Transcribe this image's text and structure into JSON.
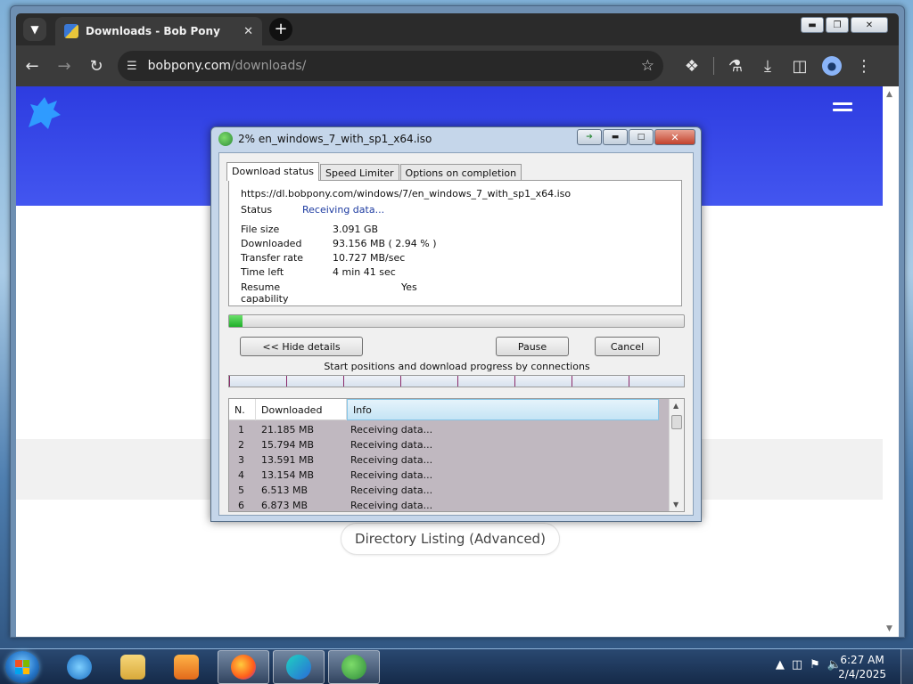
{
  "browser": {
    "tab_title": "Downloads - Bob Pony",
    "new_tab": "+",
    "url_host": "bobpony.com",
    "url_path": "/downloads/"
  },
  "page": {
    "directory_button": "Directory Listing (Advanced)"
  },
  "dialog": {
    "title": "2% en_windows_7_with_sp1_x64.iso",
    "tabs": [
      "Download status",
      "Speed Limiter",
      "Options on completion"
    ],
    "url": "https://dl.bobpony.com/windows/7/en_windows_7_with_sp1_x64.iso",
    "status_label": "Status",
    "status_value": "Receiving data...",
    "fields": {
      "file_size_label": "File size",
      "file_size": "3.091  GB",
      "downloaded_label": "Downloaded",
      "downloaded": "93.156  MB  ( 2.94 % )",
      "transfer_rate_label": "Transfer rate",
      "transfer_rate": "10.727  MB/sec",
      "time_left_label": "Time left",
      "time_left": "4 min 41 sec",
      "resume_label": "Resume capability",
      "resume": "Yes"
    },
    "progress_fraction": 0.0294,
    "buttons": {
      "hide_details": "<< Hide details",
      "pause": "Pause",
      "cancel": "Cancel"
    },
    "connections_label": "Start positions and download progress by connections",
    "list_headers": {
      "n": "N.",
      "downloaded": "Downloaded",
      "info": "Info"
    },
    "connections": [
      {
        "n": "1",
        "downloaded": "21.185  MB",
        "info": "Receiving data..."
      },
      {
        "n": "2",
        "downloaded": "15.794  MB",
        "info": "Receiving data..."
      },
      {
        "n": "3",
        "downloaded": "13.591  MB",
        "info": "Receiving data..."
      },
      {
        "n": "4",
        "downloaded": "13.154  MB",
        "info": "Receiving data..."
      },
      {
        "n": "5",
        "downloaded": "6.513  MB",
        "info": "Receiving data..."
      },
      {
        "n": "6",
        "downloaded": "6.873  MB",
        "info": "Receiving data..."
      }
    ]
  },
  "taskbar": {
    "time": "6:27 AM",
    "date": "2/4/2025"
  },
  "colors": {
    "accent_blue": "#2d3ce0",
    "progress_green": "#1fae2a",
    "status_blue": "#1c3aa0"
  }
}
